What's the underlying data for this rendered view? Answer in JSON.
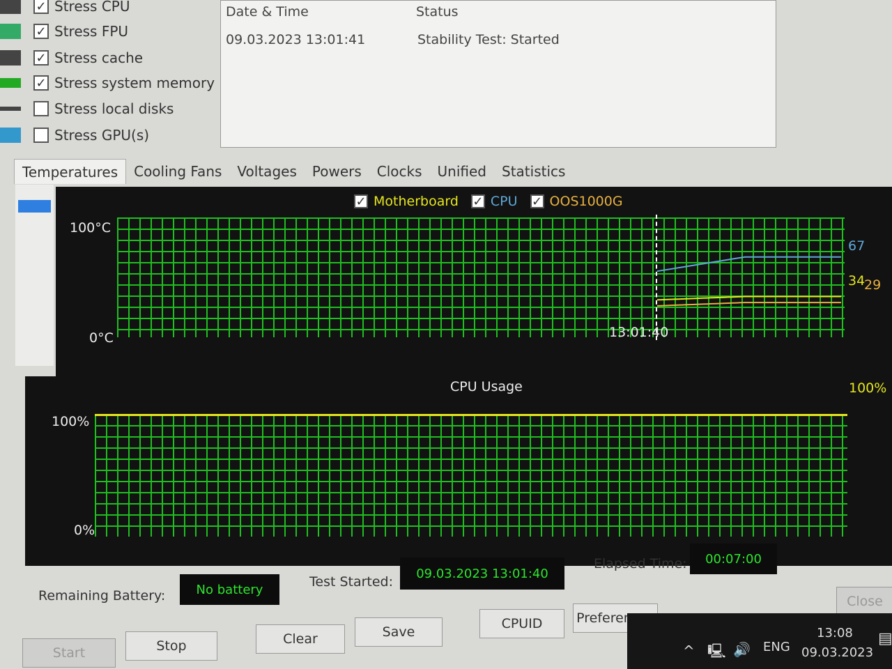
{
  "options": [
    {
      "label": "Stress CPU",
      "checked": true,
      "icon": "cpu-icon"
    },
    {
      "label": "Stress FPU",
      "checked": true,
      "icon": "fpu-icon"
    },
    {
      "label": "Stress cache",
      "checked": true,
      "icon": "cache-icon"
    },
    {
      "label": "Stress system memory",
      "checked": true,
      "icon": "memory-icon"
    },
    {
      "label": "Stress local disks",
      "checked": false,
      "icon": "disk-icon"
    },
    {
      "label": "Stress GPU(s)",
      "checked": false,
      "icon": "gpu-icon"
    }
  ],
  "log": {
    "col_date": "Date & Time",
    "col_status": "Status",
    "rows": [
      {
        "date": "09.03.2023 13:01:41",
        "status": "Stability Test: Started"
      }
    ]
  },
  "tabs": [
    "Temperatures",
    "Cooling Fans",
    "Voltages",
    "Powers",
    "Clocks",
    "Unified",
    "Statistics"
  ],
  "temp_graph": {
    "y_max": "100°C",
    "y_min": "0°C",
    "time_marker": "13:01:40",
    "legend": [
      {
        "name": "Motherboard",
        "color": "#e6e61e",
        "value": "34"
      },
      {
        "name": "CPU",
        "color": "#5fa8d8",
        "value": "67"
      },
      {
        "name": "OOS1000G",
        "color": "#e8b040",
        "value": "29"
      }
    ]
  },
  "cpu_graph": {
    "title": "CPU Usage",
    "y_max": "100%",
    "y_min": "0%",
    "current": "100%",
    "color": "#e6e61e"
  },
  "status": {
    "battery_label": "Remaining Battery:",
    "battery_value": "No battery",
    "started_label": "Test Started:",
    "started_value": "09.03.2023 13:01:40",
    "elapsed_label": "Elapsed Time:",
    "elapsed_value": "00:07:00"
  },
  "buttons": {
    "start": "Start",
    "stop": "Stop",
    "clear": "Clear",
    "save": "Save",
    "cpuid": "CPUID",
    "preferences": "Preferences",
    "close": "Close"
  },
  "taskbar": {
    "lang": "ENG",
    "time": "13:08",
    "date": "09.03.2023"
  }
}
